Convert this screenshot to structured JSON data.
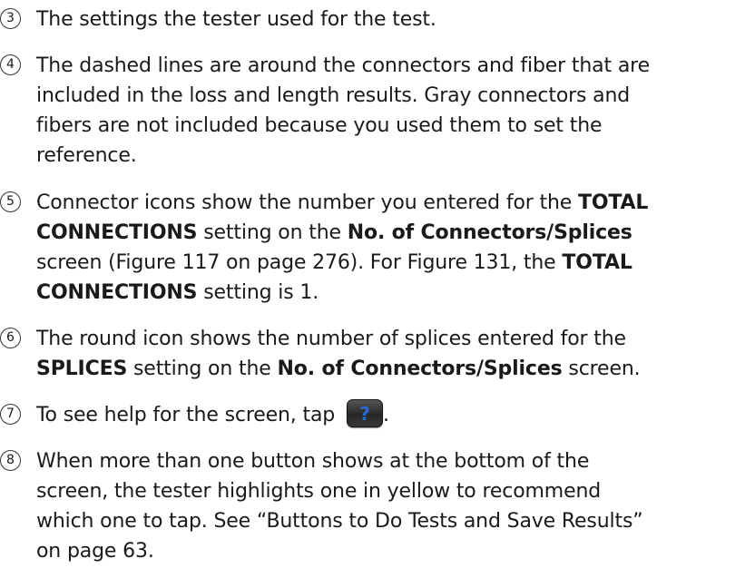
{
  "items": [
    {
      "number": "3",
      "lines": [
        [
          {
            "t": "The settings the tester used for the test.",
            "b": false
          }
        ]
      ]
    },
    {
      "number": "4",
      "lines": [
        [
          {
            "t": "The dashed lines are around the connectors and fiber that are",
            "b": false
          }
        ],
        [
          {
            "t": "included in the loss and length results. Gray connectors and",
            "b": false
          }
        ],
        [
          {
            "t": "fibers are not included because you used them to set the",
            "b": false
          }
        ],
        [
          {
            "t": "reference.",
            "b": false
          }
        ]
      ]
    },
    {
      "number": "5",
      "lines": [
        [
          {
            "t": "Connector icons show the number you entered for the ",
            "b": false
          },
          {
            "t": "TOTAL",
            "b": true
          }
        ],
        [
          {
            "t": "CONNECTIONS",
            "b": true
          },
          {
            "t": " setting on the ",
            "b": false
          },
          {
            "t": "No. of Connectors/Splices",
            "b": true
          }
        ],
        [
          {
            "t": "screen (Figure 117 on page 276). For Figure 131, the ",
            "b": false
          },
          {
            "t": "TOTAL",
            "b": true
          }
        ],
        [
          {
            "t": "CONNECTIONS",
            "b": true
          },
          {
            "t": " setting is 1.",
            "b": false
          }
        ]
      ]
    },
    {
      "number": "6",
      "lines": [
        [
          {
            "t": "The round icon shows the number of splices entered for the",
            "b": false
          }
        ],
        [
          {
            "t": "SPLICES",
            "b": true
          },
          {
            "t": " setting on the ",
            "b": false
          },
          {
            "t": "No. of Connectors/Splices",
            "b": true
          },
          {
            "t": " screen.",
            "b": false
          }
        ]
      ]
    },
    {
      "number": "7",
      "lines": [
        [
          {
            "t": "To see help for the screen, tap ",
            "b": false
          },
          {
            "icon": "help-button-icon",
            "glyph": "?"
          },
          {
            "t": ".",
            "b": false
          }
        ]
      ]
    },
    {
      "number": "8",
      "lines": [
        [
          {
            "t": "When more than one button shows at the bottom of the",
            "b": false
          }
        ],
        [
          {
            "t": "screen, the tester highlights one in yellow to recommend",
            "b": false
          }
        ],
        [
          {
            "t": "which one to tap. See “Buttons to Do Tests and Save Results”",
            "b": false
          }
        ],
        [
          {
            "t": "on page 63.",
            "b": false
          }
        ]
      ]
    }
  ],
  "colors": {
    "text": "#1a1a1a",
    "help_button_bg": "#2e2e2e",
    "help_button_glyph": "#2a6ad0"
  }
}
